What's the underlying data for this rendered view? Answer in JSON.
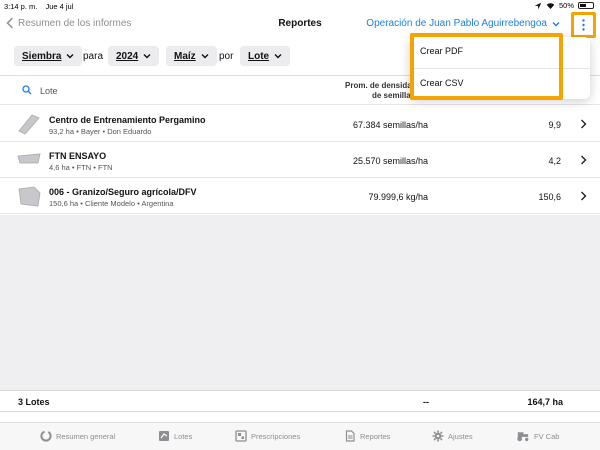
{
  "status_bar": {
    "time": "3:14 p. m.",
    "date": "Jue 4 jul",
    "battery": "50%",
    "battery_level": 0.5
  },
  "nav": {
    "back_label": "Resumen de los informes",
    "title": "Reportes",
    "operation": "Operación de Juan Pablo Aguirrebengoa"
  },
  "filters": {
    "activity": "Siembra",
    "for_label": "para",
    "year": "2024",
    "crop": "Maíz",
    "by_label": "por",
    "group": "Lote"
  },
  "search": {
    "placeholder": "Lote"
  },
  "table": {
    "column_header_line1": "Prom. de densida",
    "column_header_line2": "de semilla",
    "rows": [
      {
        "name": "Centro de Entrenamiento Pergamino",
        "sub": "93,2 ha • Bayer • Don Eduardo",
        "density": "67.384 semillas/ha",
        "value": "9,9"
      },
      {
        "name": "FTN ENSAYO",
        "sub": "4,6 ha • FTN • FTN",
        "density": "25.570 semillas/ha",
        "value": "4,2"
      },
      {
        "name": "006 - Granizo/Seguro agrícola/DFV",
        "sub": "150,6 ha • Cliente Modelo • Argentina",
        "density": "79.999,6 kg/ha",
        "value": "150,6"
      }
    ]
  },
  "footer": {
    "count": "3 Lotes",
    "dash": "--",
    "total": "164,7 ha"
  },
  "menu": {
    "items": [
      "Crear PDF",
      "Crear CSV"
    ]
  },
  "tabs": [
    {
      "label": "Resumen general",
      "icon": "circle-progress-icon"
    },
    {
      "label": "Lotes",
      "icon": "field-square-icon"
    },
    {
      "label": "Prescripciones",
      "icon": "prescription-grid-icon"
    },
    {
      "label": "Reportes",
      "icon": "document-icon"
    },
    {
      "label": "Ajustes",
      "icon": "gear-icon"
    },
    {
      "label": "FV Cab",
      "icon": "tractor-icon"
    }
  ],
  "colors": {
    "accent": "#1d7fe0",
    "highlight": "#f5a300",
    "inactive_tab": "#8e8e93"
  }
}
